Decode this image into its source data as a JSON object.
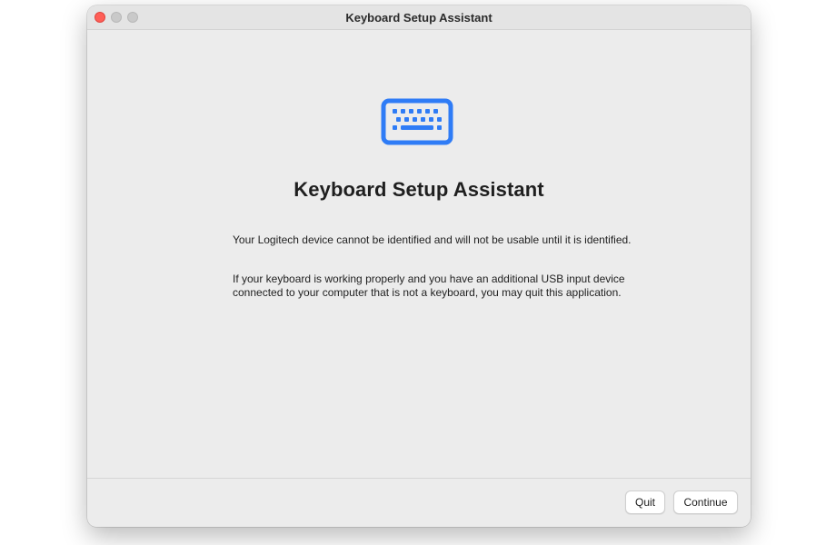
{
  "window": {
    "title": "Keyboard Setup Assistant"
  },
  "main": {
    "icon": "keyboard-icon",
    "heading": "Keyboard Setup Assistant",
    "paragraph_1": "Your Logitech device cannot be identified and will not be usable until it is identified.",
    "paragraph_2": "If your keyboard is working properly and you have an additional USB input device connected to your computer that is not a keyboard, you may quit this application."
  },
  "footer": {
    "quit_label": "Quit",
    "continue_label": "Continue"
  },
  "colors": {
    "accent": "#2f7cf6",
    "close_button": "#ff5f57",
    "window_background": "#ececec"
  }
}
